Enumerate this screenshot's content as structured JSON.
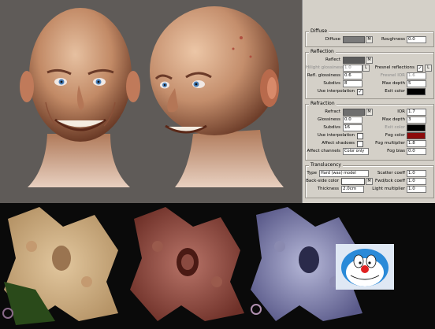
{
  "renders": {
    "head_front": "rendered-head-front",
    "head_angle": "rendered-head-three-quarter"
  },
  "panel": {
    "diffuse": {
      "title": "Diffuse",
      "diffuse_label": "Diffuse",
      "m": "M",
      "roughness_label": "Roughness",
      "roughness": "0.0"
    },
    "reflection": {
      "title": "Reflection",
      "reflect_label": "Reflect",
      "m": "M",
      "hilight_gloss_label": "Hilight glossiness",
      "hilight_gloss": "1.0",
      "l": "L",
      "fresnel_label": "Fresnel reflections",
      "fresnel_l": "L",
      "refl_gloss_label": "Refl. glossiness",
      "refl_gloss": "0.6",
      "fresnel_ior_label": "Fresnel IOR",
      "fresnel_ior": "1.6",
      "subdivs_label": "Subdivs",
      "subdivs": "8",
      "max_depth_label": "Max depth",
      "max_depth": "5",
      "use_interp_label": "Use interpolation",
      "exit_color_label": "Exit color"
    },
    "refraction": {
      "title": "Refraction",
      "refract_label": "Refract",
      "m": "M",
      "ior_label": "IOR",
      "ior": "1.7",
      "gloss_label": "Glossiness",
      "gloss": "0.0",
      "max_depth_label": "Max depth",
      "max_depth": "3",
      "subdivs_label": "Subdivs",
      "subdivs": "16",
      "exit_color_label": "Exit color",
      "use_interp_label": "Use interpolation",
      "fog_color_label": "Fog color",
      "affect_shadows_label": "Affect shadows",
      "fog_mult_label": "Fog multiplier",
      "fog_mult": "1.8",
      "affect_channels_label": "Affect channels",
      "affect_channels": "Color only",
      "fog_bias_label": "Fog bias",
      "fog_bias": "0.0"
    },
    "translucency": {
      "title": "Translucency",
      "type_label": "Type",
      "type": "Hard (wax) model",
      "scatter_label": "Scatter coeff",
      "scatter": "1.0",
      "backside_label": "Back-side color",
      "m": "M",
      "fwdbck_label": "Fwd/bck coeff",
      "fwdbck": "1.0",
      "thickness_label": "Thickness",
      "thickness": "2.0cm",
      "light_mult_label": "Light multiplier",
      "light_mult": "1.0"
    }
  },
  "colors": {
    "fog": "#8c0a0a",
    "exit_refl": "#000000",
    "exit_refr": "#000000",
    "reflect": "#5a5a5a",
    "refract": "#6e6e6e",
    "diffuse": "#7a7a7a",
    "backside": "#ffffff"
  }
}
